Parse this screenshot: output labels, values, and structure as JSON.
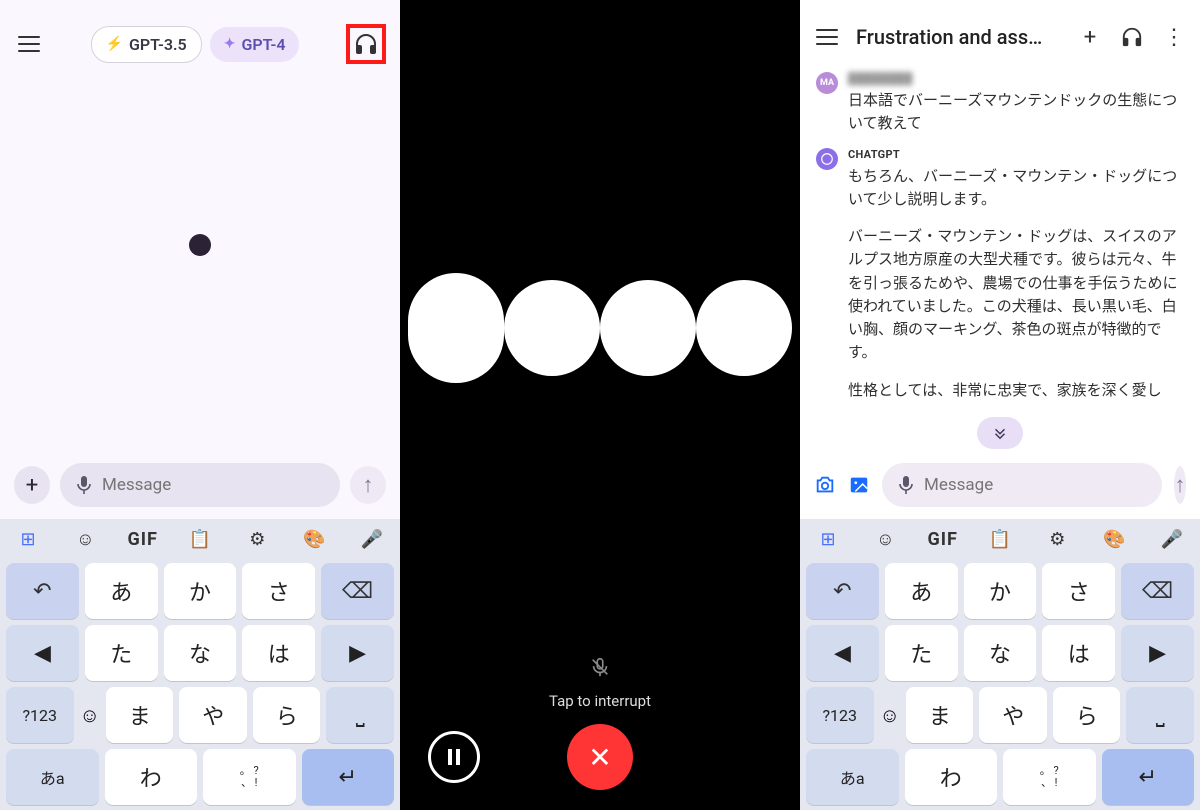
{
  "pane1": {
    "model_gpt35": "GPT-3.5",
    "model_gpt4": "GPT-4",
    "headphones_highlighted": true
  },
  "input": {
    "placeholder": "Message"
  },
  "keyboard": {
    "tools": {
      "gif": "GIF"
    },
    "rows": [
      [
        "↩",
        "あ",
        "か",
        "さ",
        "⌫"
      ],
      [
        "◀",
        "た",
        "な",
        "は",
        "▶"
      ],
      [
        "?123",
        "ま",
        "や",
        "ら",
        "␣"
      ],
      [
        "あa",
        "😊",
        "わ",
        "、。?!",
        "↵"
      ]
    ],
    "alt_label": "?123",
    "lang_label": "あa"
  },
  "voice": {
    "tap_text": "Tap to interrupt"
  },
  "pane3": {
    "title": "Frustration and ass…",
    "messages": [
      {
        "avatar": "MA",
        "sender_hidden": true,
        "sender": "████████",
        "text": "日本語でバーニーズマウンテンドックの生態について教えて"
      },
      {
        "avatar": "GPT",
        "sender": "CHATGPT",
        "paragraphs": [
          "もちろん、バーニーズ・マウンテン・ドッグについて少し説明します。",
          "バーニーズ・マウンテン・ドッグは、スイスのアルプス地方原産の大型犬種です。彼らは元々、牛を引っ張るためや、農場での仕事を手伝うために使われていました。この犬種は、長い黒い毛、白い胸、顔のマーキング、茶色の斑点が特徴的です。",
          "性格としては、非常に忠実で、家族を深く愛し"
        ]
      }
    ]
  },
  "icons": {
    "plus": "+",
    "up": "↑",
    "close": "✕",
    "more": "⋮"
  }
}
